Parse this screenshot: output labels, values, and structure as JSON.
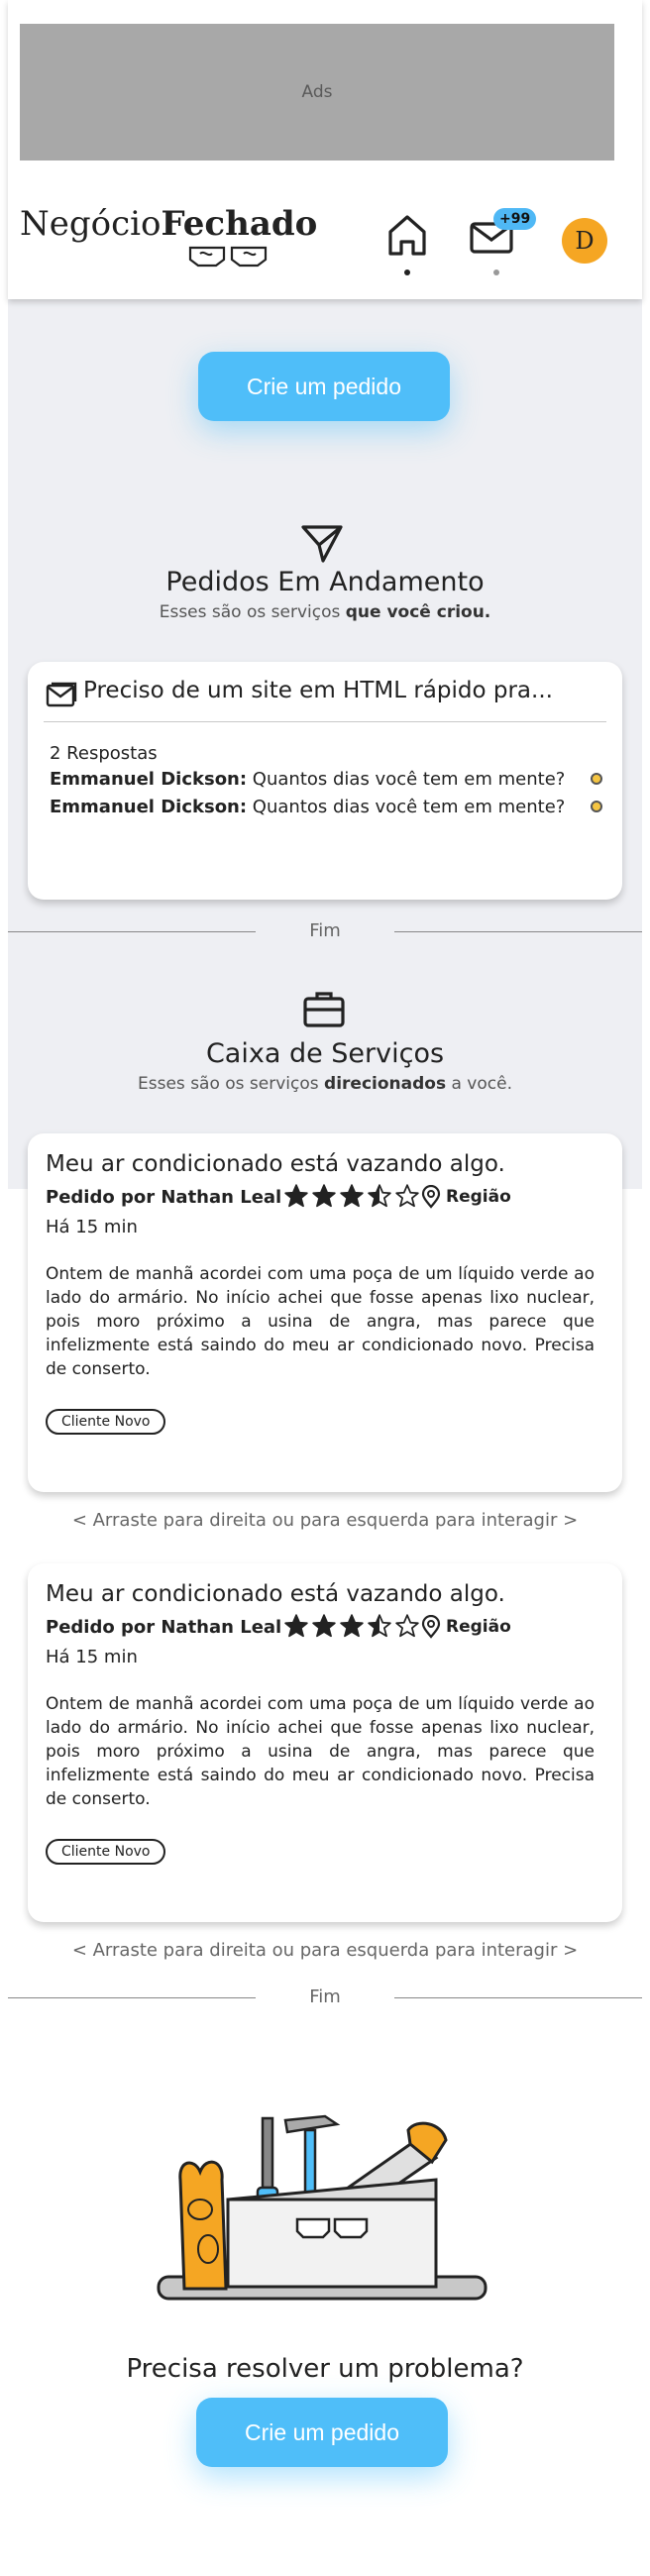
{
  "ads": {
    "label": "Ads"
  },
  "logo": {
    "part1": "Negócio",
    "part2": "Fechado"
  },
  "nav": {
    "mail_badge": "+99",
    "avatar_initial": "D"
  },
  "cta": {
    "label": "Crie um pedido"
  },
  "in_progress": {
    "title": "Pedidos Em Andamento",
    "subtitle_prefix": "Esses são os serviços ",
    "subtitle_bold": "que você criou.",
    "request": {
      "title": "Preciso de um site em HTML rápido pra...",
      "replies_count": "2 Respostas",
      "replies": [
        {
          "author": "Emmanuel Dickson:",
          "text": " Quantos dias você tem em mente?"
        },
        {
          "author": "Emmanuel Dickson:",
          "text": " Quantos dias você tem em mente?"
        }
      ]
    },
    "end_label": "Fim"
  },
  "services": {
    "title": "Caixa de Serviços",
    "subtitle_prefix": "Esses são os serviços ",
    "subtitle_bold": "direcionados",
    "subtitle_suffix": " a você.",
    "cards": [
      {
        "title": "Meu ar condicionado está vazando algo.",
        "by": "Pedido por Nathan Leal",
        "rating": 3.5,
        "region": "Região",
        "time": "Há 15 min",
        "description": "Ontem de manhã acordei com uma poça de um líquido verde ao lado do armário. No início achei que fosse apenas lixo nuclear, pois moro próximo a usina de angra, mas parece que infelizmente está saindo do meu ar condicionado novo. Precisa de conserto.",
        "tag": "Cliente Novo",
        "hint": "<  Arraste para direita ou para esquerda para interagir  >"
      },
      {
        "title": "Meu ar condicionado está vazando algo.",
        "by": "Pedido por Nathan Leal",
        "rating": 3.5,
        "region": "Região",
        "time": "Há 15 min",
        "description": "Ontem de manhã acordei com uma poça de um líquido verde ao lado do armário. No início achei que fosse apenas lixo nuclear, pois moro próximo a usina de angra, mas parece que infelizmente está saindo do meu ar condicionado novo. Precisa de conserto.",
        "tag": "Cliente Novo",
        "hint": "<  Arraste para direita ou para esquerda para interagir  >"
      }
    ],
    "end_label": "Fim"
  },
  "footer": {
    "question": "Precisa resolver um problema?",
    "cta_label": "Crie um pedido"
  },
  "colors": {
    "accent": "#4fbef9",
    "badge": "#4fb8f5",
    "avatar": "#f5a623",
    "unread_dot": "#f5c542",
    "page_bg": "#eeeff3"
  }
}
